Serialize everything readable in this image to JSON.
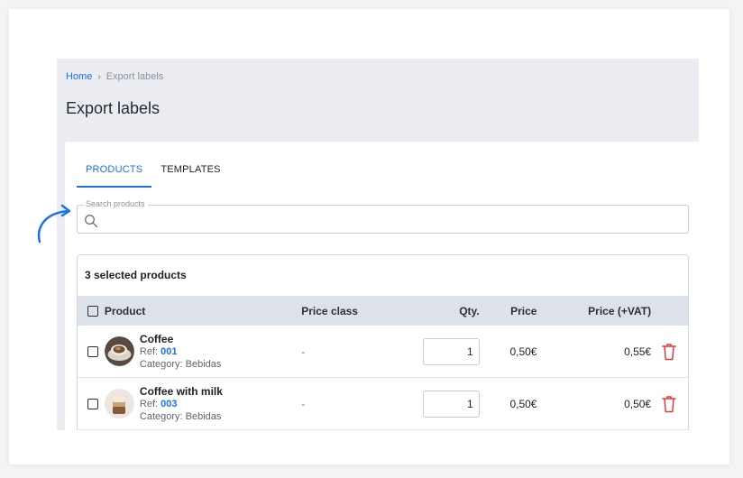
{
  "breadcrumb": {
    "home": "Home",
    "separator": "›",
    "current": "Export labels"
  },
  "page": {
    "title": "Export labels"
  },
  "tabs": [
    {
      "label": "PRODUCTS",
      "active": true
    },
    {
      "label": "TEMPLATES",
      "active": false
    }
  ],
  "search": {
    "label": "Search products",
    "value": "",
    "placeholder": ""
  },
  "table": {
    "selected_count": "3 selected products",
    "headers": {
      "product": "Product",
      "price_class": "Price class",
      "qty": "Qty.",
      "price": "Price",
      "price_vat": "Price (+VAT)"
    },
    "rows": [
      {
        "name": "Coffee",
        "ref_label": "Ref:",
        "ref": "001",
        "category": "Category: Bebidas",
        "price_class": "-",
        "qty": "1",
        "price": "0,50€",
        "price_vat": "0,55€"
      },
      {
        "name": "Coffee with milk",
        "ref_label": "Ref:",
        "ref": "003",
        "category": "Category: Bebidas",
        "price_class": "-",
        "qty": "1",
        "price": "0,50€",
        "price_vat": "0,50€"
      }
    ]
  },
  "colors": {
    "accent": "#1a73e8",
    "delete": "#e53935",
    "header_bg": "#dde2ea",
    "page_bg": "#ecedf2"
  },
  "icons": {
    "search": "search-icon",
    "delete": "trash-icon",
    "annotation": "curved-arrow-icon"
  }
}
